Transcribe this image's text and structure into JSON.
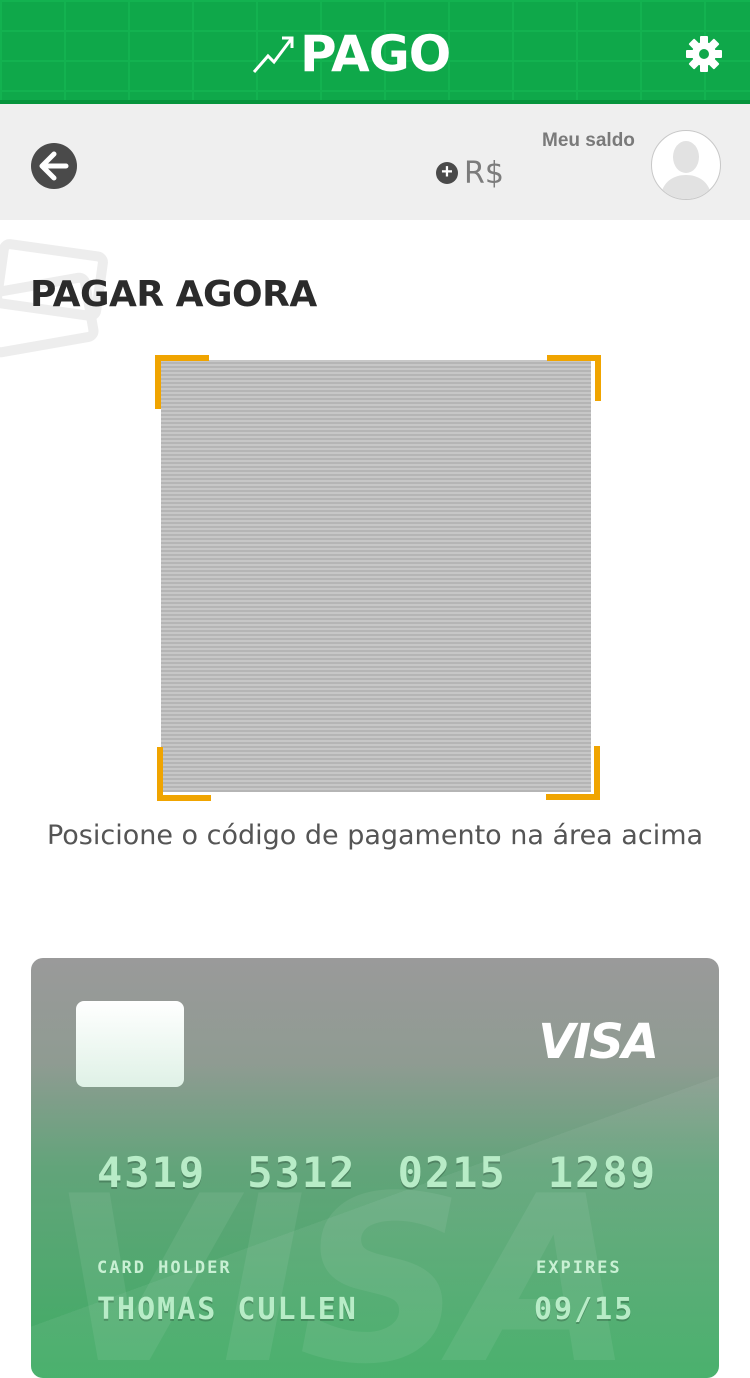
{
  "header": {
    "logo_text": "PAGO",
    "settings_icon": "gear-icon",
    "colors": {
      "brand": "#0fa84a",
      "accent": "#f0a400"
    }
  },
  "balance": {
    "back_icon": "arrow-left-icon",
    "add_icon": "plus-circle-icon",
    "currency": "R$",
    "label": "Meu saldo",
    "avatar_icon": "user-avatar-icon"
  },
  "main": {
    "title": "PAGAR AGORA",
    "instruction": "Posicione o código de pagamento na área acima"
  },
  "card": {
    "brand": "VISA",
    "number_groups": [
      "4319",
      "5312",
      "0215",
      "1289"
    ],
    "holder_label": "CARD HOLDER",
    "holder_name": "THOMAS CULLEN",
    "expires_label": "EXPIRES",
    "expires_value": "09/15"
  }
}
